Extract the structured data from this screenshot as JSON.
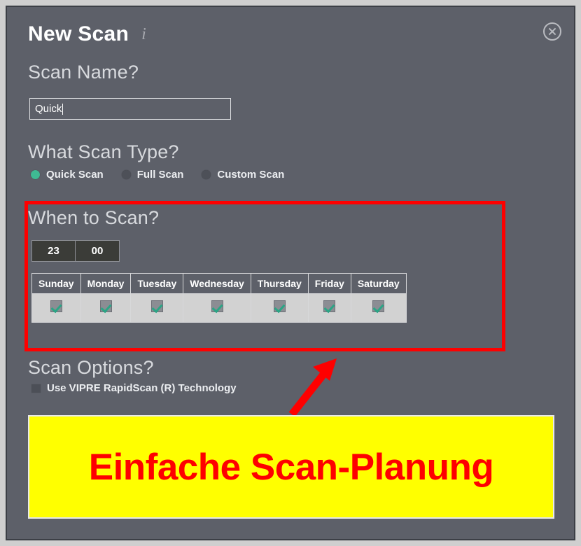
{
  "dialog": {
    "title": "New Scan",
    "info_icon": "info-icon",
    "close_icon": "close-icon"
  },
  "scan_name": {
    "heading": "Scan Name?",
    "value": "Quick",
    "placeholder": ""
  },
  "scan_type": {
    "heading": "What Scan Type?",
    "options": [
      {
        "label": "Quick Scan",
        "selected": true
      },
      {
        "label": "Full Scan",
        "selected": false
      },
      {
        "label": "Custom Scan",
        "selected": false
      }
    ]
  },
  "schedule": {
    "heading": "When to Scan?",
    "hour": "23",
    "minute": "00",
    "days": [
      {
        "label": "Sunday",
        "checked": true
      },
      {
        "label": "Monday",
        "checked": true
      },
      {
        "label": "Tuesday",
        "checked": true
      },
      {
        "label": "Wednesday",
        "checked": true
      },
      {
        "label": "Thursday",
        "checked": true
      },
      {
        "label": "Friday",
        "checked": true
      },
      {
        "label": "Saturday",
        "checked": true
      }
    ]
  },
  "scan_options": {
    "heading": "Scan Options?",
    "rapidscan_label": "Use VIPRE RapidScan (R) Technology",
    "rapidscan_checked": false
  },
  "annotation": {
    "banner_text": "Einfache Scan-Planung",
    "banner_bg": "#ffff00",
    "banner_fg": "#fe0000",
    "highlight_color": "#fe0000",
    "arrow_color": "#fe0000"
  },
  "colors": {
    "dialog_bg": "#5d6069",
    "accent_teal": "#3fba93",
    "frame": "#cfcfcf"
  }
}
